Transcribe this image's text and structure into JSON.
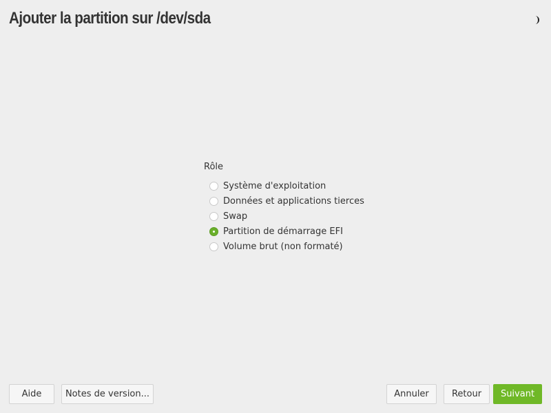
{
  "header": {
    "title": "Ajouter la partition sur /dev/sda",
    "theme_toggle_icon": "half-moon-icon"
  },
  "role": {
    "label": "Rôle",
    "options": [
      {
        "label": "Système d'exploitation",
        "checked": false
      },
      {
        "label": "Données et applications tierces",
        "checked": false
      },
      {
        "label": "Swap",
        "checked": false
      },
      {
        "label": "Partition de démarrage EFI",
        "checked": true
      },
      {
        "label": "Volume brut (non formaté)",
        "checked": false
      }
    ]
  },
  "footer": {
    "help_label": "Aide",
    "release_notes_label": "Notes de version...",
    "cancel_label": "Annuler",
    "back_label": "Retour",
    "next_label": "Suivant"
  },
  "colors": {
    "accent": "#6fb827",
    "background": "#eeeeee",
    "text": "#333333"
  }
}
